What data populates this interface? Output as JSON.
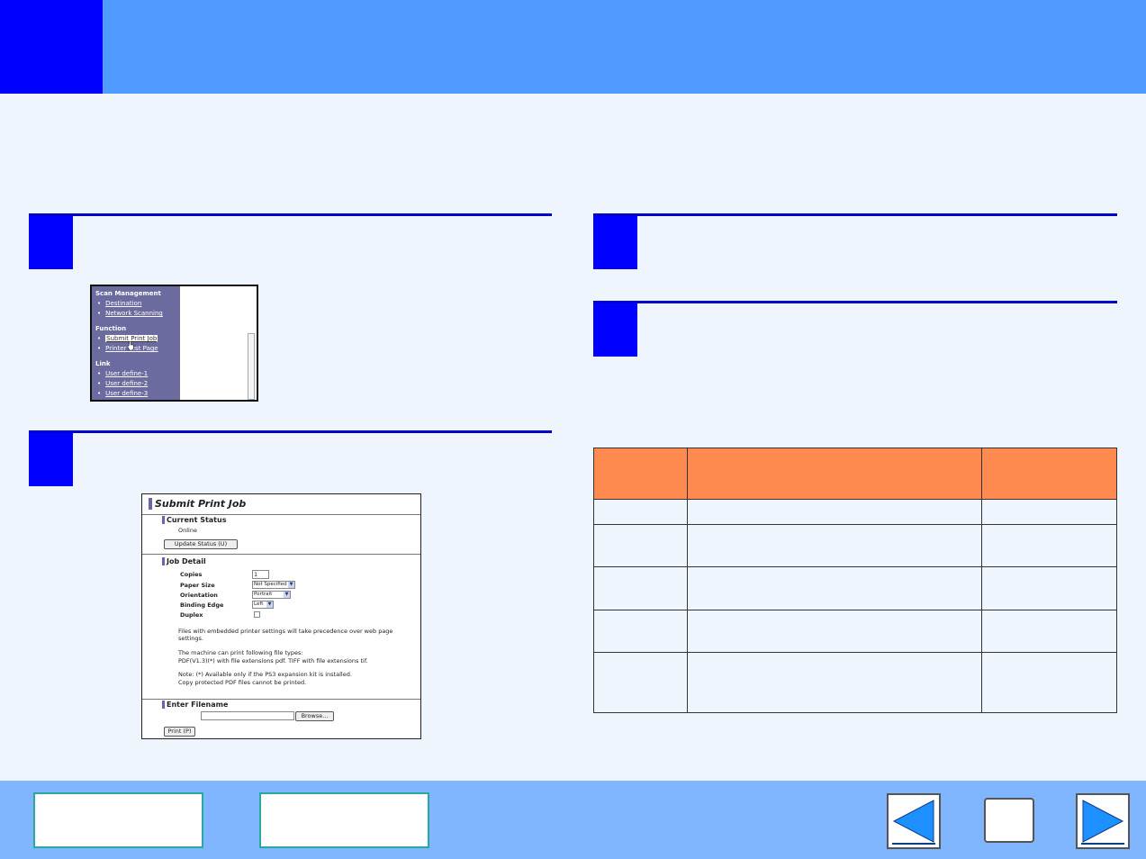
{
  "colors": {
    "header": "#4f9bff",
    "accent": "#0000ff",
    "table_header": "#ff8a4f",
    "footer": "#80b6ff"
  },
  "menu_screenshot": {
    "sections": [
      {
        "title": "Scan Management",
        "links": [
          "Destination",
          "Network Scanning"
        ]
      },
      {
        "title": "Function",
        "links": [
          "Submit Print Job",
          "Printer Test Page"
        ]
      },
      {
        "title": "Link",
        "links": [
          "User define-1",
          "User define-2",
          "User define-3"
        ]
      }
    ],
    "selected_link": "Submit Print Job"
  },
  "form_screenshot": {
    "title": "Submit Print Job",
    "current_status_heading": "Current Status",
    "status_value": "Online",
    "update_button": "Update Status (U)",
    "job_detail_heading": "Job Detail",
    "copies_label": "Copies",
    "copies_value": "1",
    "paper_size_label": "Paper Size",
    "paper_size_value": "Not Specified",
    "orientation_label": "Orientation",
    "orientation_value": "Portrait",
    "binding_edge_label": "Binding Edge",
    "binding_edge_value": "Left",
    "duplex_label": "Duplex",
    "note1": "Files with embedded printer settings will take precedence over web page settings.",
    "note2a": "The machine can print following file types:",
    "note2b": "PDF(V1.3)(*) with file extensions pdf. TIFF with file extensions tif.",
    "note3a": "Note: (*) Available only if the PS3 expansion kit is installed.",
    "note3b": "Copy protected PDF files cannot be printed.",
    "enter_filename_heading": "Enter Filename",
    "browse_button": "Browse...",
    "print_button": "Print (P)"
  }
}
